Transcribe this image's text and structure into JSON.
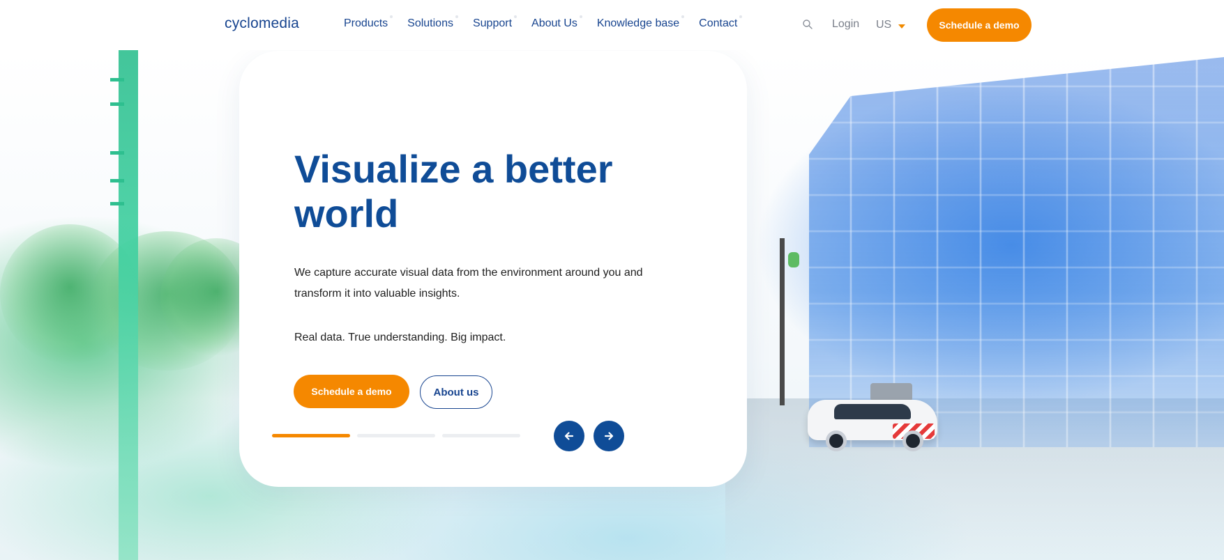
{
  "nav": {
    "logo": "cyclomedia",
    "menu": [
      "Products",
      "Solutions",
      "Support",
      "About Us",
      "Knowledge base",
      "Contact"
    ],
    "search_icon": "search-icon",
    "login": "Login",
    "language": "US",
    "cta": "Schedule a demo"
  },
  "hero": {
    "headline": "Visualize a better world",
    "lead": "We capture accurate visual data from the environment around you and transform it into valuable insights.",
    "tagline": "Real data. True understanding. Big impact.",
    "primary_button": "Schedule a demo",
    "secondary_button": "About us",
    "slider": {
      "slides": 3,
      "active_slide": 1,
      "prev_icon": "arrow-left-icon",
      "next_icon": "arrow-right-icon"
    }
  },
  "colors": {
    "brand_blue": "#0f4c97",
    "accent_orange": "#f58800",
    "text": "#1d1d1d"
  }
}
